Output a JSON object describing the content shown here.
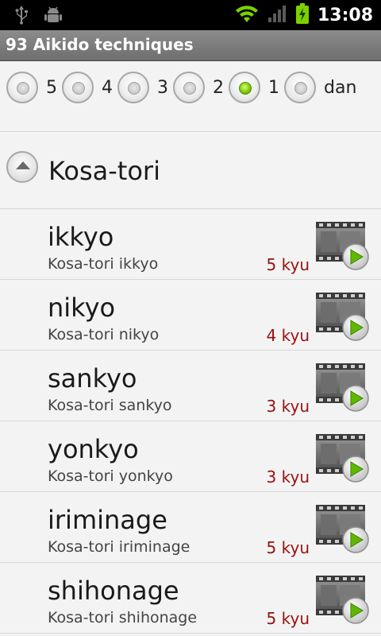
{
  "status": {
    "time": "13:08"
  },
  "app": {
    "title": "93 Aikido techniques"
  },
  "levels": [
    {
      "label": "5",
      "selected": false
    },
    {
      "label": "4",
      "selected": false
    },
    {
      "label": "3",
      "selected": false
    },
    {
      "label": "2",
      "selected": false
    },
    {
      "label": "1",
      "selected": true
    },
    {
      "label": "dan",
      "selected": false
    }
  ],
  "group": {
    "title": "Kosa-tori"
  },
  "techniques": [
    {
      "name": "ikkyo",
      "subtitle": "Kosa-tori ikkyo",
      "grade": "5 kyu"
    },
    {
      "name": "nikyo",
      "subtitle": "Kosa-tori nikyo",
      "grade": "4 kyu"
    },
    {
      "name": "sankyo",
      "subtitle": "Kosa-tori sankyo",
      "grade": "3 kyu"
    },
    {
      "name": "yonkyo",
      "subtitle": "Kosa-tori yonkyo",
      "grade": "3 kyu"
    },
    {
      "name": "iriminage",
      "subtitle": "Kosa-tori iriminage",
      "grade": "5 kyu"
    },
    {
      "name": "shihonage",
      "subtitle": "Kosa-tori shihonage",
      "grade": "5 kyu"
    }
  ],
  "colors": {
    "grade": "#9a1010",
    "selected_radio": "#77c400"
  },
  "icons": {
    "usb": "usb-icon",
    "debug": "android-debug-icon",
    "wifi": "wifi-icon",
    "signal": "signal-icon",
    "battery": "battery-charging-icon",
    "collapse": "chevron-up-icon",
    "video": "video-play-icon"
  }
}
